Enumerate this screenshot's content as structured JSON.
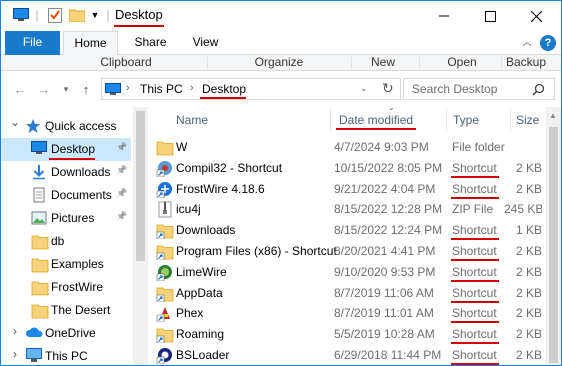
{
  "window": {
    "title": "Desktop",
    "controls": {
      "minimize": "minimize",
      "maximize": "maximize",
      "close": "close"
    }
  },
  "ribbon": {
    "tabs": [
      "File",
      "Home",
      "Share",
      "View"
    ],
    "groups": [
      "Clipboard",
      "Organize",
      "New",
      "Open",
      "Backup"
    ]
  },
  "address": {
    "crumbs": [
      "This PC",
      "Desktop"
    ],
    "search_placeholder": "Search Desktop"
  },
  "nav": {
    "items": [
      {
        "label": "Quick access",
        "icon": "star-icon",
        "level": 0,
        "expander": "expanded"
      },
      {
        "label": "Desktop",
        "icon": "desktop-icon",
        "level": 1,
        "pinned": true,
        "selected": true
      },
      {
        "label": "Downloads",
        "icon": "download-icon",
        "level": 1,
        "pinned": true
      },
      {
        "label": "Documents",
        "icon": "documents-icon",
        "level": 1,
        "pinned": true
      },
      {
        "label": "Pictures",
        "icon": "pictures-icon",
        "level": 1,
        "pinned": true
      },
      {
        "label": "db",
        "icon": "folder-icon",
        "level": 1
      },
      {
        "label": "Examples",
        "icon": "folder-icon",
        "level": 1
      },
      {
        "label": "FrostWire",
        "icon": "folder-icon",
        "level": 1
      },
      {
        "label": "The Desert",
        "icon": "folder-icon",
        "level": 1
      },
      {
        "label": "OneDrive",
        "icon": "cloud-icon",
        "level": 0,
        "expander": "collapsed"
      },
      {
        "label": "This PC",
        "icon": "computer-icon",
        "level": 0,
        "expander": "collapsed"
      }
    ]
  },
  "list": {
    "columns": {
      "name": "Name",
      "date": "Date modified",
      "type": "Type",
      "size": "Size"
    },
    "sort_column": "date",
    "files": [
      {
        "name": "W",
        "date": "4/7/2024 9:03 PM",
        "type": "File folder",
        "size": "",
        "icon": "folder-icon"
      },
      {
        "name": "Compil32 - Shortcut",
        "date": "10/15/2022 8:05 PM",
        "type": "Shortcut",
        "size": "2 KB",
        "icon": "shortcut-app-icon"
      },
      {
        "name": "FrostWire 4.18.6",
        "date": "9/21/2022 4:04 PM",
        "type": "Shortcut",
        "size": "2 KB",
        "icon": "frostwire-icon"
      },
      {
        "name": "icu4j",
        "date": "8/15/2022 12:28 PM",
        "type": "ZIP File",
        "size": "245 KB",
        "icon": "zip-icon"
      },
      {
        "name": "Downloads",
        "date": "8/15/2022 12:24 PM",
        "type": "Shortcut",
        "size": "1 KB",
        "icon": "folder-shortcut-icon"
      },
      {
        "name": "Program Files (x86) - Shortcut",
        "date": "8/20/2021 4:41 PM",
        "type": "Shortcut",
        "size": "2 KB",
        "icon": "folder-shortcut-icon"
      },
      {
        "name": "LimeWire",
        "date": "9/10/2020 9:53 PM",
        "type": "Shortcut",
        "size": "2 KB",
        "icon": "limewire-icon"
      },
      {
        "name": "AppData",
        "date": "8/7/2019 11:06 AM",
        "type": "Shortcut",
        "size": "2 KB",
        "icon": "folder-shortcut-icon"
      },
      {
        "name": "Phex",
        "date": "8/7/2019 11:01 AM",
        "type": "Shortcut",
        "size": "2 KB",
        "icon": "phex-icon"
      },
      {
        "name": "Roaming",
        "date": "5/5/2019 10:28 AM",
        "type": "Shortcut",
        "size": "2 KB",
        "icon": "folder-shortcut-icon"
      },
      {
        "name": "BSLoader",
        "date": "6/29/2018 11:44 PM",
        "type": "Shortcut",
        "size": "2 KB",
        "icon": "bsloader-icon"
      }
    ]
  },
  "colors": {
    "accent": "#1979ca",
    "selection": "#cce8ff",
    "annotation": "#d40000",
    "folder": "#f6d37b"
  }
}
